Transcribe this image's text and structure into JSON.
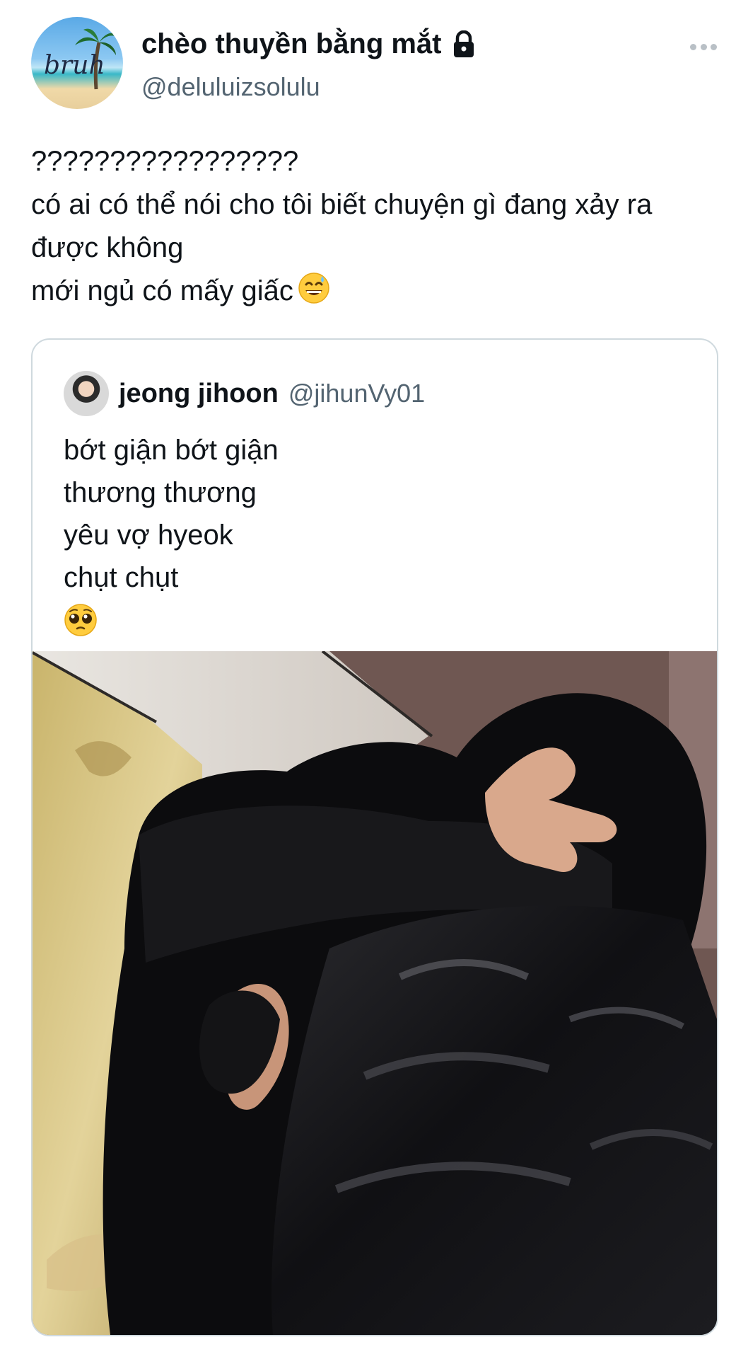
{
  "author": {
    "display_name": "chèo thuyền bằng mắt",
    "handle": "@deluluizsolulu",
    "avatar_text": "bruh",
    "locked": true
  },
  "tweet": {
    "lines": "?????????????????\ncó ai có thể nói cho tôi biết chuyện gì đang xảy ra được không\nmới ngủ có mấy giấc",
    "trailing_emoji": "grinning-sweat-emoji"
  },
  "quoted": {
    "display_name": "jeong jihoon",
    "handle": "@jihunVy01",
    "text": "bớt giận bớt giận\nthương thương\nyêu vợ hyeok\nchụt chụt",
    "emoji": "pleading-face-emoji",
    "media": "photo-two-people-hugging-in-black-puffer-jackets"
  },
  "icons": {
    "lock": "lock-icon",
    "more": "more-options-icon"
  },
  "colors": {
    "text_primary": "#0f1419",
    "text_secondary": "#536471",
    "border": "#cfd9de"
  }
}
